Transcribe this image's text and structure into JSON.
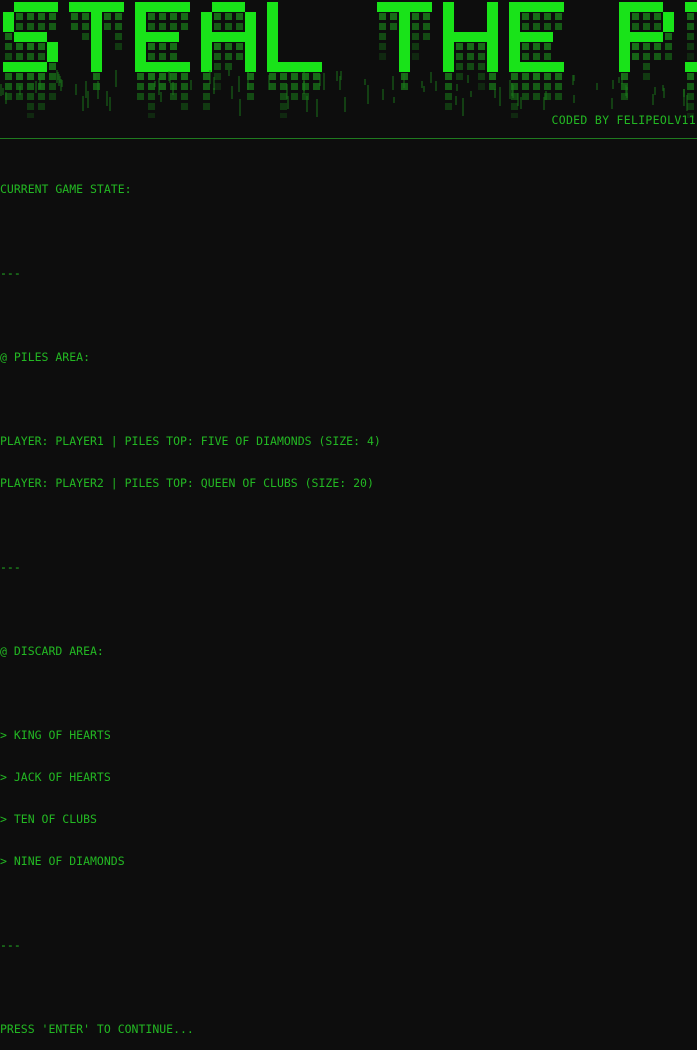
{
  "banner": {
    "title": "STEAL THE PILE",
    "credit": "CODED BY FELIPEOLV11",
    "colors": {
      "bright": "#19e319",
      "dim": "#1a7d1a",
      "text": "#23b823",
      "background": "#0d0d0d"
    }
  },
  "state": {
    "heading": "CURRENT GAME STATE:",
    "separator": "---",
    "piles_heading": "@ PILES AREA:",
    "piles": [
      "PLAYER: PLAYER1 | PILES TOP: FIVE OF DIAMONDS (SIZE: 4)",
      "PLAYER: PLAYER2 | PILES TOP: QUEEN OF CLUBS (SIZE: 20)"
    ],
    "discard_heading": "@ DISCARD AREA:",
    "discard": [
      "> KING OF HEARTS",
      "> JACK OF HEARTS",
      "> TEN OF CLUBS",
      "> NINE OF DIAMONDS"
    ],
    "prompt": "PRESS 'ENTER' TO CONTINUE..."
  }
}
